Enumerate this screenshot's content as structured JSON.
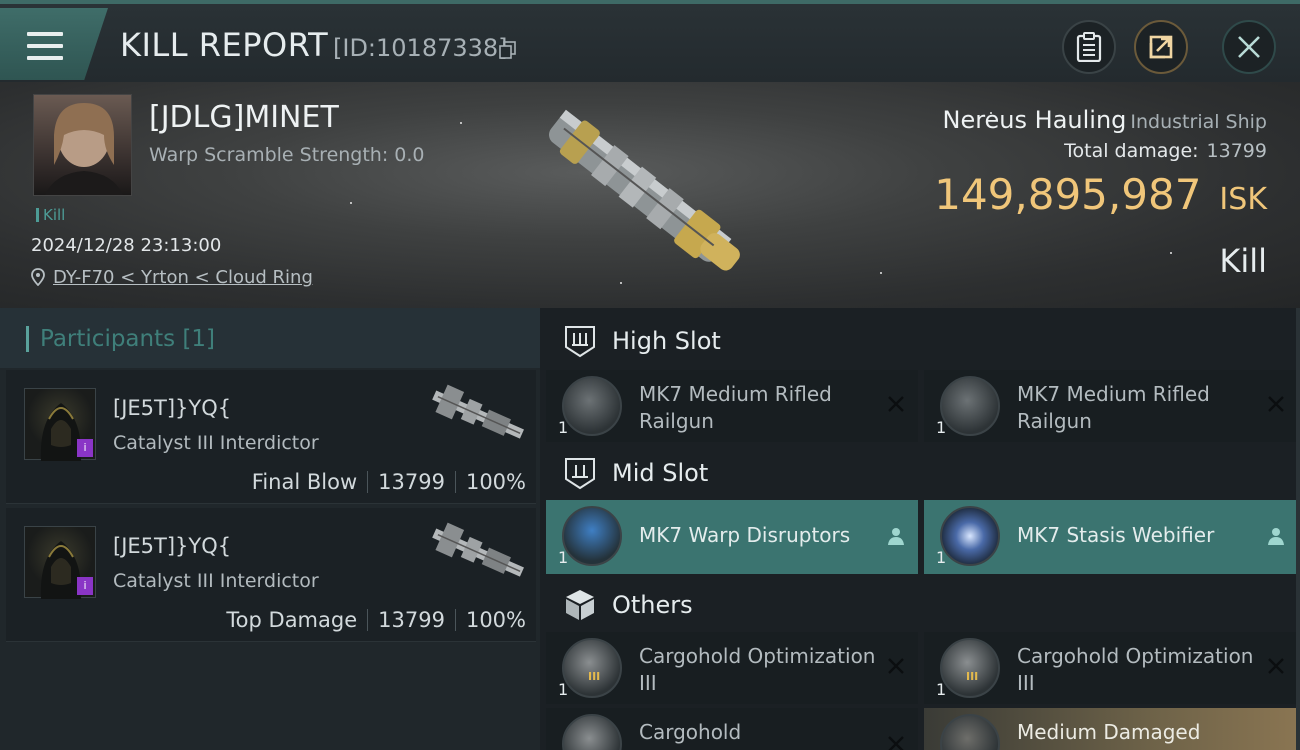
{
  "header": {
    "title": "KILL REPORT",
    "report_id": "[ID:10187338]"
  },
  "victim": {
    "name": "[JDLG]MINET",
    "warp_scramble": "Warp Scramble Strength: 0.0",
    "tag": "Kill",
    "date": "2024/12/28 23:13:00",
    "location": "DY-F70 < Yrton < Cloud Ring",
    "ship_name": "Nereus Hauling",
    "ship_class": "Industrial Ship",
    "total_damage_label": "Total damage:",
    "total_damage": "13799",
    "isk_value": "149,895,987",
    "isk_unit": "ISK",
    "result": "Kill"
  },
  "participants": {
    "header": "Participants [1]",
    "items": [
      {
        "name": "[JE5T]}YQ{",
        "ship": "Catalyst III Interdictor",
        "role": "Final Blow",
        "damage": "13799",
        "percent": "100%"
      },
      {
        "name": "[JE5T]}YQ{",
        "ship": "Catalyst III Interdictor",
        "role": "Top Damage",
        "damage": "13799",
        "percent": "100%"
      }
    ]
  },
  "slots": {
    "high": {
      "label": "High Slot",
      "items": [
        {
          "qty": "1",
          "name": "MK7 Medium Rifled Railgun"
        },
        {
          "qty": "1",
          "name": "MK7 Medium Rifled Railgun"
        }
      ]
    },
    "mid": {
      "label": "Mid Slot",
      "items": [
        {
          "qty": "1",
          "name": "MK7 Warp Disruptors"
        },
        {
          "qty": "1",
          "name": "MK7 Stasis Webifier"
        }
      ]
    },
    "others": {
      "label": "Others",
      "items": [
        {
          "qty": "1",
          "name": "Cargohold Optimization III"
        },
        {
          "qty": "1",
          "name": "Cargohold Optimization III"
        },
        {
          "qty": "",
          "name": "Cargohold"
        },
        {
          "qty": "",
          "name": "Medium Damaged"
        }
      ]
    }
  },
  "colors": {
    "accent": "#3b7470",
    "isk": "#f0c67a",
    "corp_badge": "#8a35c6"
  },
  "icons": [
    "menu-icon",
    "copy-icon",
    "clipboard-icon",
    "share-icon",
    "close-icon",
    "location-pin-icon",
    "high-slot-icon",
    "mid-slot-icon",
    "others-cube-icon",
    "remove-x-icon",
    "person-icon"
  ]
}
